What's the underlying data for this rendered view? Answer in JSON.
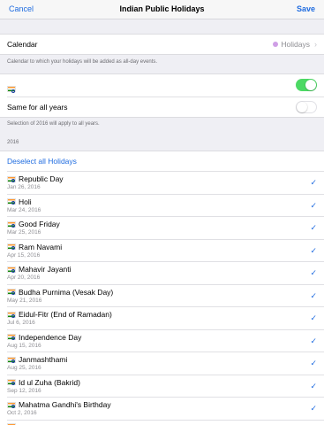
{
  "nav": {
    "cancel_label": "Cancel",
    "title": "Indian Public Holidays",
    "save_label": "Save"
  },
  "calendar": {
    "label": "Calendar",
    "value": "Holidays",
    "dot_color": "#cf9ee6",
    "footnote": "Calendar to which your holidays will be added as all-day events."
  },
  "country": {
    "flag_icon": "india-flag-icon",
    "toggle_on": true
  },
  "same_years": {
    "label": "Same for all years",
    "toggle_on": false,
    "footnote": "Selection of 2016 will apply to all years."
  },
  "section": {
    "year_header": "2016",
    "deselect_label": "Deselect all Holidays"
  },
  "holidays": [
    {
      "name": "Republic Day",
      "date": "Jan 26, 2016",
      "checked": true
    },
    {
      "name": "Holi",
      "date": "Mar 24, 2016",
      "checked": true
    },
    {
      "name": "Good Friday",
      "date": "Mar 25, 2016",
      "checked": true
    },
    {
      "name": "Ram Navami",
      "date": "Apr 15, 2016",
      "checked": true
    },
    {
      "name": "Mahavir Jayanti",
      "date": "Apr 20, 2016",
      "checked": true
    },
    {
      "name": "Budha Purnima (Vesak Day)",
      "date": "May 21, 2016",
      "checked": true
    },
    {
      "name": "Eidul-Fitr (End of Ramadan)",
      "date": "Jul 6, 2016",
      "checked": true
    },
    {
      "name": "Independence Day",
      "date": "Aug 15, 2016",
      "checked": true
    },
    {
      "name": "Janmashthami",
      "date": "Aug 25, 2016",
      "checked": true
    },
    {
      "name": "Id ul Zuha (Bakrid)",
      "date": "Sep 12, 2016",
      "checked": true
    },
    {
      "name": "Mahatma Gandhi's Birthday",
      "date": "Oct 2, 2016",
      "checked": true
    }
  ],
  "colors": {
    "accent": "#1f6ce0",
    "toggle_on": "#4cd964",
    "background": "#efeff4"
  }
}
